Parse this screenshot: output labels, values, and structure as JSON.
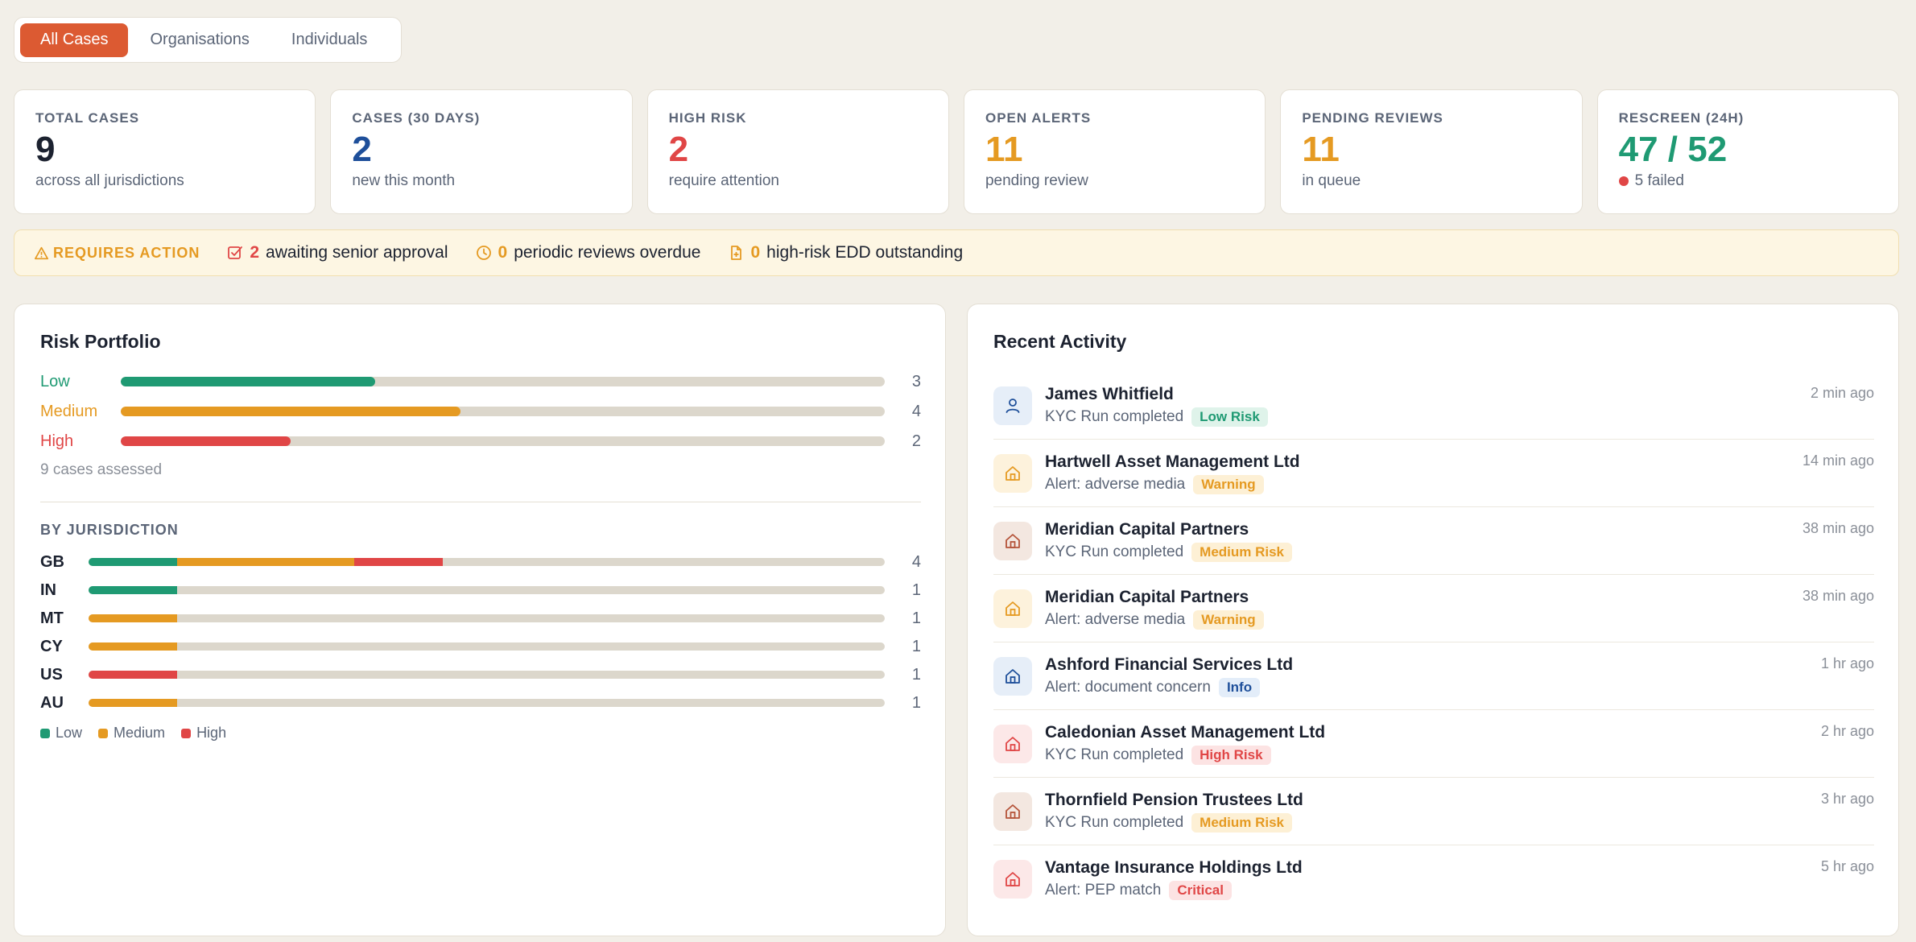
{
  "tabs": [
    {
      "label": "All Cases",
      "active": true
    },
    {
      "label": "Organisations",
      "active": false
    },
    {
      "label": "Individuals",
      "active": false
    }
  ],
  "stats": [
    {
      "label": "TOTAL CASES",
      "value": "9",
      "sub": "across all jurisdictions",
      "color": "#1c2230"
    },
    {
      "label": "CASES (30 DAYS)",
      "value": "2",
      "sub": "new this month",
      "color": "#1e4f9a"
    },
    {
      "label": "HIGH RISK",
      "value": "2",
      "sub": "require attention",
      "color": "#e04646"
    },
    {
      "label": "OPEN ALERTS",
      "value": "11",
      "sub": "pending review",
      "color": "#e59a22"
    },
    {
      "label": "PENDING REVIEWS",
      "value": "11",
      "sub": "in queue",
      "color": "#e59a22"
    },
    {
      "label": "RESCREEN (24H)",
      "value": "47 / 52",
      "sub": "5 failed",
      "color": "#1f9a73"
    }
  ],
  "action_bar": {
    "title": "REQUIRES ACTION",
    "items": [
      {
        "count": "2",
        "text": "awaiting senior approval",
        "icon": "checkbox-icon",
        "color": "#e04646"
      },
      {
        "count": "0",
        "text": "periodic reviews overdue",
        "icon": "clock-icon",
        "color": "#e59a22"
      },
      {
        "count": "0",
        "text": "high-risk EDD outstanding",
        "icon": "document-icon",
        "color": "#e59a22"
      }
    ]
  },
  "risk_portfolio": {
    "title": "Risk Portfolio",
    "total": 9,
    "rows": [
      {
        "label": "Low",
        "count": 3,
        "color": "#1f9a73"
      },
      {
        "label": "Medium",
        "count": 4,
        "color": "#e59a22"
      },
      {
        "label": "High",
        "count": 2,
        "color": "#e04646"
      }
    ],
    "assessed": "9 cases assessed",
    "jurisdiction_title": "BY JURISDICTION",
    "jurisdiction_scale": 9,
    "jurisdictions": [
      {
        "code": "GB",
        "low": 1,
        "medium": 2,
        "high": 1,
        "total": 4
      },
      {
        "code": "IN",
        "low": 1,
        "medium": 0,
        "high": 0,
        "total": 1
      },
      {
        "code": "MT",
        "low": 0,
        "medium": 1,
        "high": 0,
        "total": 1
      },
      {
        "code": "CY",
        "low": 0,
        "medium": 1,
        "high": 0,
        "total": 1
      },
      {
        "code": "US",
        "low": 0,
        "medium": 0,
        "high": 1,
        "total": 1
      },
      {
        "code": "AU",
        "low": 0,
        "medium": 1,
        "high": 0,
        "total": 1
      }
    ],
    "legend": [
      {
        "label": "Low",
        "color": "#1f9a73"
      },
      {
        "label": "Medium",
        "color": "#e59a22"
      },
      {
        "label": "High",
        "color": "#e04646"
      }
    ]
  },
  "recent_activity": {
    "title": "Recent Activity",
    "items": [
      {
        "name": "James Whitfield",
        "desc": "KYC Run completed",
        "badge": "Low Risk",
        "badge_kind": "low",
        "time": "2 min ago",
        "icon": "person-icon",
        "tone": "blue"
      },
      {
        "name": "Hartwell Asset Management Ltd",
        "desc": "Alert: adverse media",
        "badge": "Warning",
        "badge_kind": "warning",
        "time": "14 min ago",
        "icon": "building-icon",
        "tone": "amber"
      },
      {
        "name": "Meridian Capital Partners",
        "desc": "KYC Run completed",
        "badge": "Medium Risk",
        "badge_kind": "medium",
        "time": "38 min ago",
        "icon": "building-icon",
        "tone": "brown"
      },
      {
        "name": "Meridian Capital Partners",
        "desc": "Alert: adverse media",
        "badge": "Warning",
        "badge_kind": "warning",
        "time": "38 min ago",
        "icon": "building-icon",
        "tone": "amber"
      },
      {
        "name": "Ashford Financial Services Ltd",
        "desc": "Alert: document concern",
        "badge": "Info",
        "badge_kind": "info",
        "time": "1 hr ago",
        "icon": "building-icon",
        "tone": "blue"
      },
      {
        "name": "Caledonian Asset Management Ltd",
        "desc": "KYC Run completed",
        "badge": "High Risk",
        "badge_kind": "high",
        "time": "2 hr ago",
        "icon": "building-icon",
        "tone": "red"
      },
      {
        "name": "Thornfield Pension Trustees Ltd",
        "desc": "KYC Run completed",
        "badge": "Medium Risk",
        "badge_kind": "medium",
        "time": "3 hr ago",
        "icon": "building-icon",
        "tone": "brown"
      },
      {
        "name": "Vantage Insurance Holdings Ltd",
        "desc": "Alert: PEP match",
        "badge": "Critical",
        "badge_kind": "critical",
        "time": "5 hr ago",
        "icon": "building-icon",
        "tone": "red"
      }
    ]
  }
}
